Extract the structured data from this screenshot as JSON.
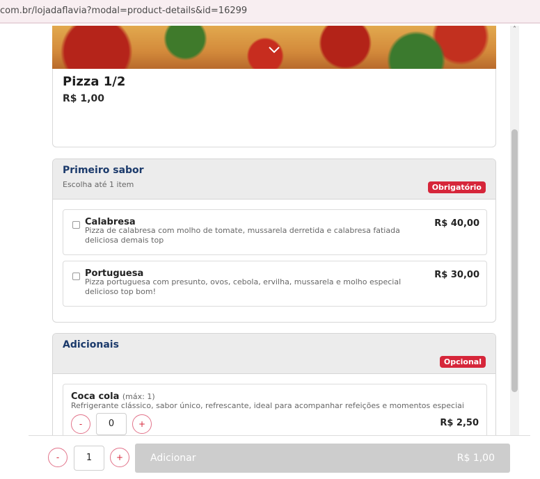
{
  "browser": {
    "url": "com.br/lojadaflavia?modal=product-details&id=16299"
  },
  "product": {
    "name": "Pizza 1/2",
    "price": "R$ 1,00"
  },
  "groups": [
    {
      "title": "Primeiro sabor",
      "subtitle": "Escolha até 1 item",
      "badge": "Obrigatório",
      "items": [
        {
          "name": "Calabresa",
          "description": "Pizza de calabresa com molho de tomate, mussarela derretida e calabresa fatiada deliciosa demais top",
          "price": "R$ 40,00",
          "checked": false
        },
        {
          "name": "Portuguesa",
          "description": "Pizza portuguesa com presunto, ovos, cebola, ervilha, mussarela e molho especial delicioso top bom!",
          "price": "R$ 30,00",
          "checked": false
        }
      ]
    },
    {
      "title": "Adicionais",
      "badge": "Opcional",
      "addons": [
        {
          "name": "Coca cola",
          "max": "(máx: 1)",
          "description": "Refrigerante clássico, sabor único, refrescante, ideal para acompanhar refeições e momentos especiai",
          "price": "R$ 2,50",
          "quantity": "0",
          "minus": "-",
          "plus": "+"
        }
      ]
    }
  ],
  "footer": {
    "minus": "-",
    "quantity": "1",
    "plus": "+",
    "add_label": "Adicionar",
    "total": "R$ 1,00"
  },
  "colors": {
    "accent": "#d6263a",
    "title_blue": "#1b3a6b",
    "disabled_button": "#cdcdcd"
  },
  "icons": {
    "hero": "chevron-down-icon",
    "scroll": "chevron-up-icon"
  }
}
